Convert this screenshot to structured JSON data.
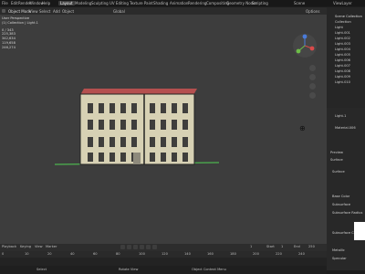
{
  "menu": {
    "items": [
      "File",
      "Edit",
      "Render",
      "Window",
      "Help"
    ]
  },
  "workspace_tabs": [
    "Layout",
    "Modeling",
    "Sculpting",
    "UV Editing",
    "Texture Paint",
    "Shading",
    "Animation",
    "Rendering",
    "Compositing",
    "Geometry Nodes",
    "Scripting"
  ],
  "active_tab": "Layout",
  "scene_label": "Scene",
  "view_layer_label": "ViewLayer",
  "viewport_header": {
    "mode": "Object Mode",
    "items": [
      "View",
      "Select",
      "Add",
      "Object"
    ],
    "transform": "Global",
    "options": "Options"
  },
  "viewport_overlay": {
    "lines": [
      "User Perspective",
      "(1) Collection | Light.1",
      "",
      "Objects",
      "Vertices",
      "Edges",
      "Faces",
      "Triangles"
    ],
    "values": [
      "0 / 343",
      "225,383",
      "342,634",
      "119,658",
      "246,274"
    ]
  },
  "outliner": {
    "title": "Scene Collection",
    "items": [
      "Collection",
      "Light",
      "Light.001",
      "Light.002",
      "Light.003",
      "Light.004",
      "Light.005",
      "Light.006",
      "Light.007",
      "Light.008",
      "Light.009",
      "Light.010"
    ]
  },
  "properties": {
    "object": "Light.1",
    "material": "Material.006",
    "sections": [
      "Preview",
      "Surface"
    ],
    "labels": [
      "Surface",
      "Base Color",
      "Subsurface",
      "Subsurface Radius",
      "Subsurface Color",
      "Metallic",
      "Specular"
    ]
  },
  "timeline": {
    "menus": [
      "Playback",
      "Keying",
      "View",
      "Marker"
    ],
    "current_frame": "1",
    "start_label": "Start",
    "start": "1",
    "end_label": "End",
    "end": "250",
    "ruler": [
      "0",
      "10",
      "20",
      "40",
      "60",
      "80",
      "100",
      "120",
      "140",
      "160",
      "180",
      "200",
      "220",
      "240"
    ]
  },
  "statusbar": {
    "items": [
      "Select",
      "Rotate View",
      "Object Context Menu"
    ],
    "version": "3.4.1"
  },
  "building_colors": {
    "roof": "#b5504f",
    "wall": "#d7d1b4",
    "window": "#3f3e3c",
    "grass": "#4aa04c"
  }
}
